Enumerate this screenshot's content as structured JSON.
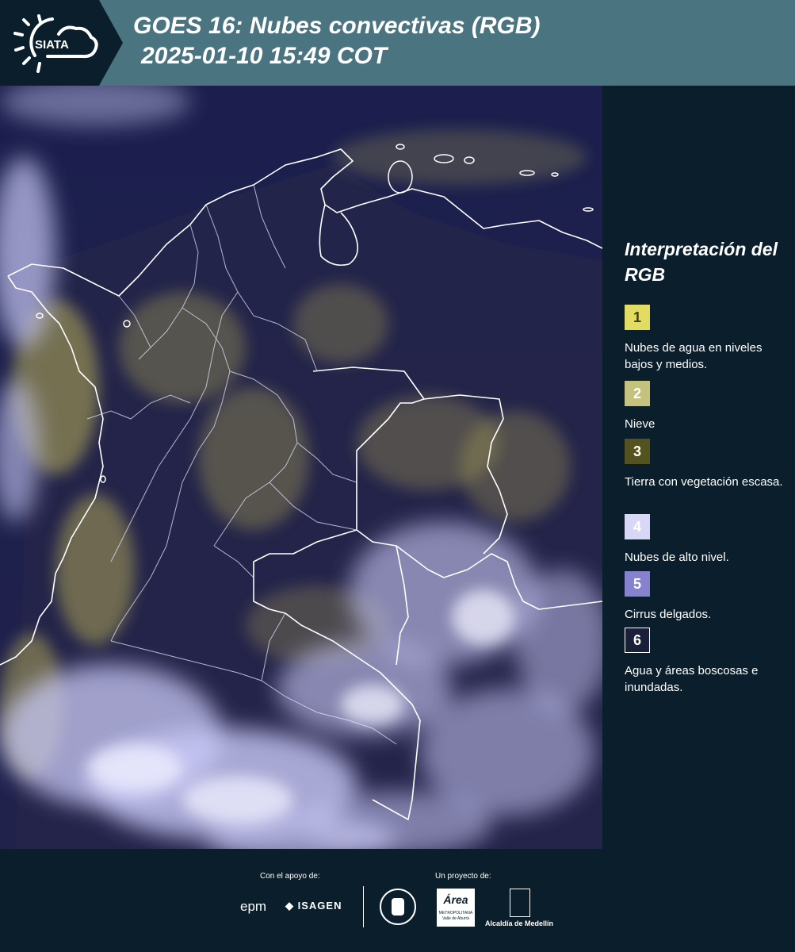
{
  "header": {
    "brand": "SIATA",
    "title_line1": "GOES 16: Nubes convectivas (RGB)",
    "title_line2": "2025-01-10 15:49 COT",
    "background": "#4b7481"
  },
  "map": {
    "background": "#1b1f4a",
    "border_color": "#ffffff",
    "cloud_high_color": "#c9c9f7",
    "cloud_low_color": "#cfc66a"
  },
  "legend": {
    "title": "Interpretación del RGB",
    "items": [
      {
        "number": "1",
        "label": "Nubes de agua en niveles bajos y medios.",
        "color": "#e2dc63"
      },
      {
        "number": "2",
        "label": "Nieve",
        "color": "#c5c27d"
      },
      {
        "number": "3",
        "label": "Tierra con vegetación escasa.",
        "color": "#54521f"
      },
      {
        "number": "4",
        "label": "Nubes de alto nivel.",
        "color": "#d8d7f6"
      },
      {
        "number": "5",
        "label": "Cirrus delgados.",
        "color": "#8682cf"
      },
      {
        "number": "6",
        "label": "Agua y áreas boscosas e inundadas.",
        "color": "#1a1f3a"
      }
    ]
  },
  "footer": {
    "support_caption": "Con el apoyo de:",
    "project_caption": "Un proyecto de:",
    "logos": {
      "epm": "epm",
      "isagen": "ISAGEN",
      "area_metropolitana": "Área",
      "area_metropolitana_sub": "METROPOLITANA Valle de Aburrá",
      "alcaldia": "Alcaldía de Medellín"
    }
  }
}
